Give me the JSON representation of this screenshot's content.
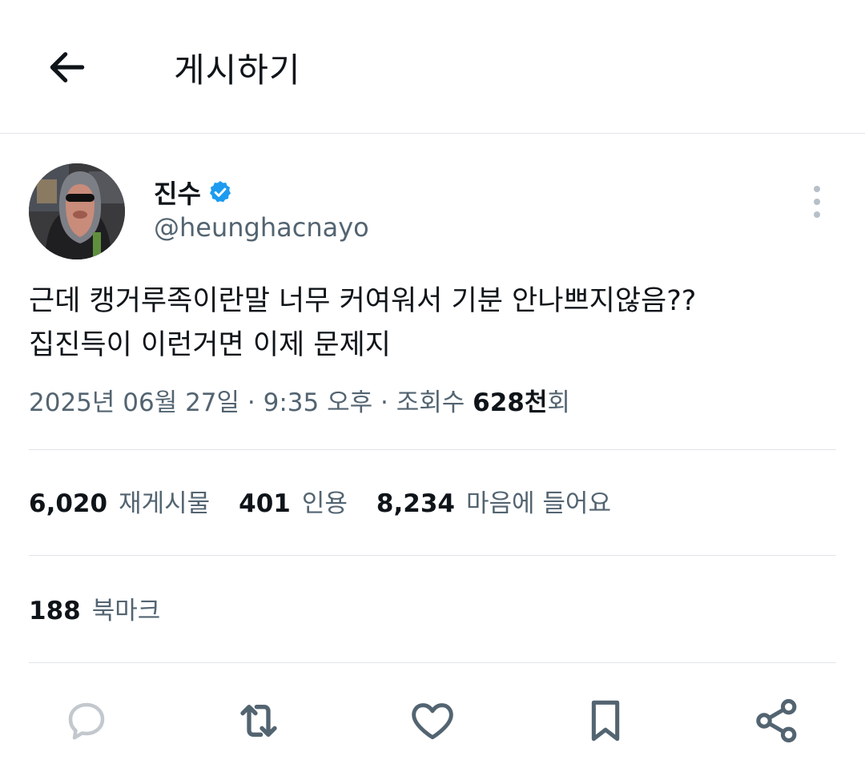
{
  "header": {
    "title": "게시하기",
    "back_icon": "arrow-left-icon"
  },
  "author": {
    "display_name": "진수",
    "handle": "@heunghacnayo",
    "verified": true,
    "verified_color": "#1d9bf0"
  },
  "tweet": {
    "lines": [
      "근데 캥거루족이란말 너무 커여워서 기분 안나쁘지않음??",
      "집진득이 이런거면 이제 문제지"
    ],
    "meta": {
      "date": "2025년 06월 27일",
      "separator": " · ",
      "time": "9:35 오후",
      "views_label": "조회수 ",
      "views_count": "628천",
      "views_suffix": "회"
    }
  },
  "stats": {
    "retweets": {
      "count": "6,020",
      "label": "재게시물"
    },
    "quotes": {
      "count": "401",
      "label": "인용"
    },
    "likes": {
      "count": "8,234",
      "label": "마음에 들어요"
    },
    "bookmarks": {
      "count": "188",
      "label": "북마크"
    }
  },
  "actions": [
    {
      "icon": "reply-icon"
    },
    {
      "icon": "retweet-icon"
    },
    {
      "icon": "heart-icon"
    },
    {
      "icon": "bookmark-icon"
    },
    {
      "icon": "share-icon"
    }
  ],
  "colors": {
    "text_primary": "#0f1419",
    "text_secondary": "#536471",
    "divider": "#e1e4e8"
  }
}
